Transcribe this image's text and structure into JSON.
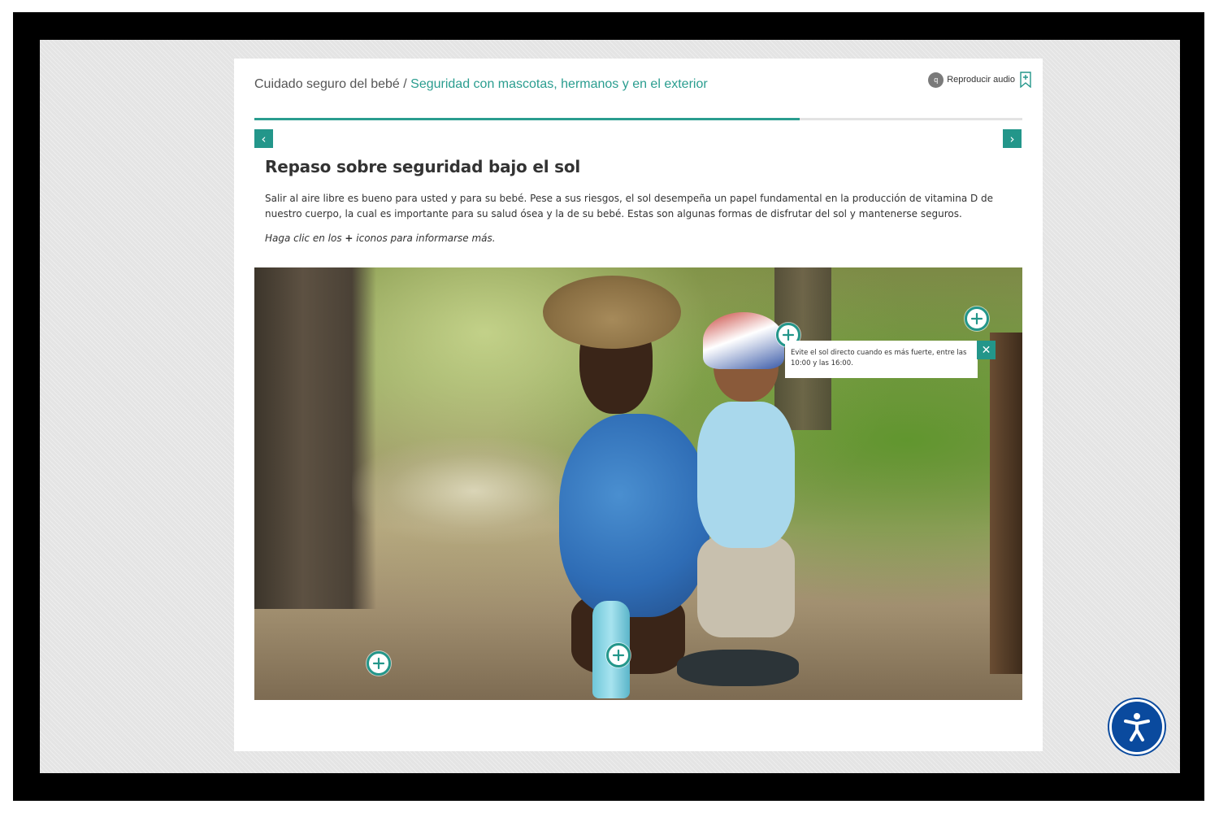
{
  "header": {
    "breadcrumb_parent": "Cuidado seguro del bebé",
    "breadcrumb_separator": " / ",
    "breadcrumb_current": "Seguridad con mascotas, hermanos y en el exterior",
    "audio_icon_letter": "q",
    "audio_label": "Reproducir audio",
    "audio_icon": "audio-icon",
    "bookmark_icon": "bookmark-plus-icon"
  },
  "progress": {
    "percent": 71
  },
  "nav": {
    "prev_glyph": "‹",
    "next_glyph": "›"
  },
  "content": {
    "title": "Repaso sobre seguridad bajo el sol",
    "body": "Salir al aire libre es bueno para usted y para su bebé. Pese a sus riesgos, el sol desempeña un papel fundamental en la producción de vitamina D de nuestro cuerpo, la cual es importante para su salud ósea y la de su bebé. Estas son algunas formas de disfrutar del sol y mantenerse seguros.",
    "instruction_prefix": "Haga clic en los ",
    "instruction_plus": "+",
    "instruction_suffix": " iconos para informarse más."
  },
  "tooltip": {
    "text": "Evite el sol directo cuando es más fuerte, entre las 10:00 y las 16:00.",
    "close_glyph": "✕"
  },
  "colors": {
    "accent": "#23968a",
    "breadcrumb_link": "#2a9d8f",
    "accessibility_button": "#0a4a9e"
  },
  "accessibility": {
    "icon": "accessibility-icon"
  }
}
